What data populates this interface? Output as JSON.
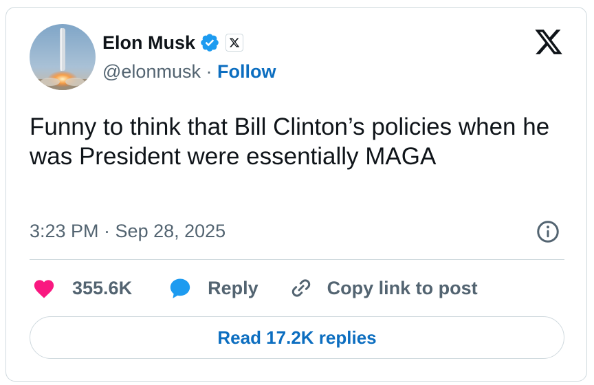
{
  "author": {
    "name": "Elon Musk",
    "handle": "@elonmusk",
    "separator": " · ",
    "follow_label": "Follow"
  },
  "tweet": {
    "text": "Funny to think that Bill Clinton’s policies when he was President were essentially MAGA",
    "timestamp": "3:23 PM · Sep 28, 2025"
  },
  "actions": {
    "likes": "355.6K",
    "reply_label": "Reply",
    "copy_link_label": "Copy link to post"
  },
  "read_replies_label": "Read 17.2K replies",
  "icons": [
    "verified-badge-icon",
    "x-badge-icon",
    "x-logo-icon",
    "info-icon",
    "heart-icon",
    "reply-icon",
    "link-icon"
  ],
  "colors": {
    "accent": "#0c6ec0",
    "verified": "#1d9bf0",
    "heart": "#f91880",
    "muted_text": "#536471",
    "border": "#cfd9de"
  }
}
